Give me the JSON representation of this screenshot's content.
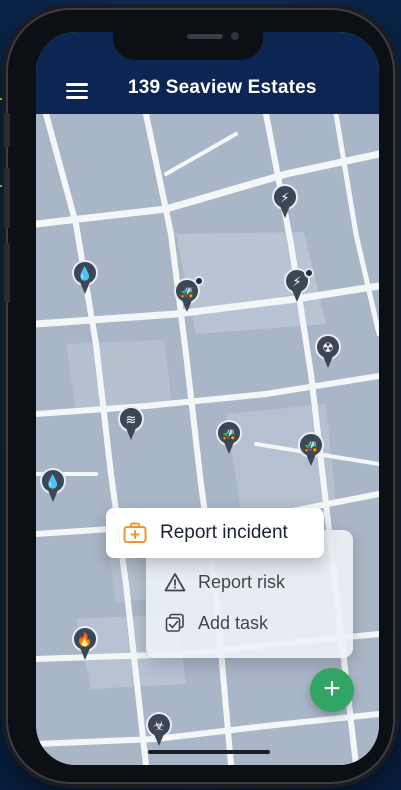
{
  "header": {
    "title": "139 Seaview Estates",
    "menu_icon": "hamburger-menu-icon"
  },
  "menu": {
    "report_incident": {
      "label": "Report incident",
      "icon": "first-aid-kit-icon",
      "color": "#f0952b"
    },
    "report_risk": {
      "label": "Report risk",
      "icon": "warning-triangle-icon"
    },
    "add_task": {
      "label": "Add task",
      "icon": "task-check-icon"
    }
  },
  "fab": {
    "label": "+",
    "icon": "plus-icon",
    "color": "#31a564"
  },
  "colors": {
    "header_bg": "#0c2553",
    "map_road": "#f4f6f8",
    "map_block": "#a9b6c7",
    "pin": "#3b4656"
  },
  "pins": [
    {
      "icon": "lightning-icon"
    },
    {
      "icon": "water-drop-icon"
    },
    {
      "icon": "tractor-icon"
    },
    {
      "icon": "lightning-icon"
    },
    {
      "icon": "radiation-icon"
    },
    {
      "icon": "flood-icon"
    },
    {
      "icon": "tractor-icon"
    },
    {
      "icon": "tractor-icon"
    },
    {
      "icon": "water-drop-icon"
    },
    {
      "icon": "fire-icon"
    },
    {
      "icon": "gas-mask-icon"
    }
  ]
}
